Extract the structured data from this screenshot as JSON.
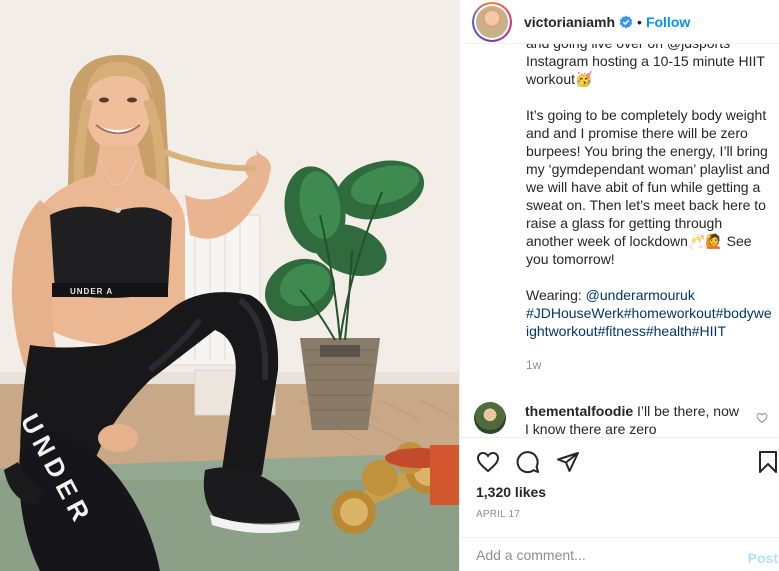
{
  "header": {
    "username": "victorianiamh",
    "separator": "•",
    "follow_label": "Follow"
  },
  "caption": {
    "paragraphs": [
      "and going live over on @jdsports Instagram hosting a 10-15 minute HIIT workout🥳",
      "It’s going to be completely body weight and and I promise there will be zero burpees! You bring the energy, I’ll bring my ‘gymdependant woman’ playlist and we will have abit of fun while getting a sweat on. Then let’s meet back here to raise a glass for getting through another week of lockdown🥂🙋 See you tomorrow!"
    ],
    "wearing_label": "Wearing: ",
    "wearing_link": "@underarmouruk",
    "hashtags": "#JDHouseWerk#homeworkout#bodyweightworkout#fitness#health#HIIT",
    "posted": "1w"
  },
  "comment": {
    "username": "thementalfoodie",
    "text": "I’ll be there, now I know there are zero"
  },
  "likes": "1,320 likes",
  "date": "APRIL 17",
  "add_comment": {
    "placeholder": "Add a comment...",
    "post_label": "Post"
  },
  "photo": {
    "bra_text": "UNDER A",
    "legging_text": "UNDER"
  },
  "colors": {
    "accent": "#0095f6",
    "link": "#00376b",
    "muted": "#8e8e8e",
    "post_disabled": "#b2dffc"
  }
}
